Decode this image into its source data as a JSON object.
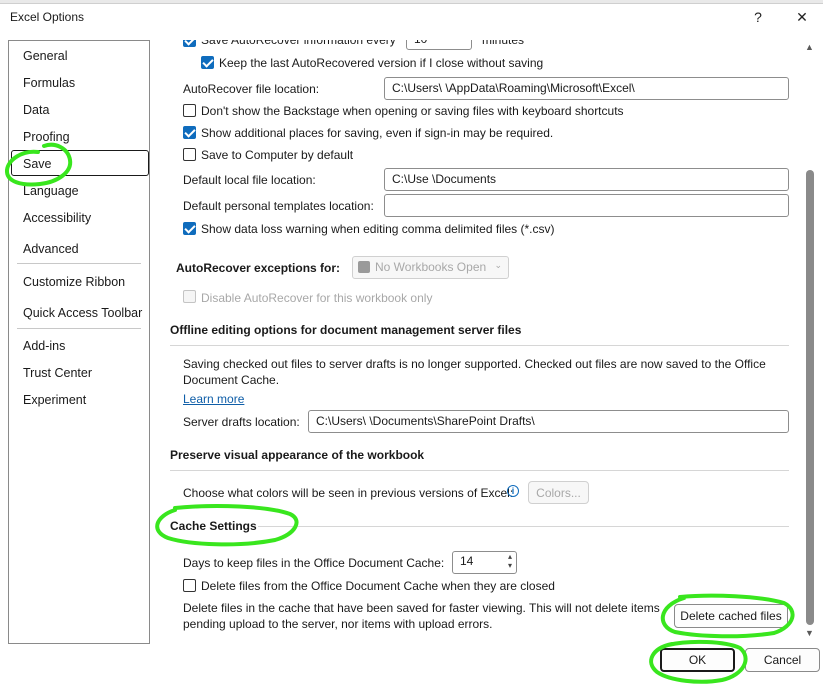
{
  "window": {
    "title": "Excel Options",
    "help": "?",
    "close": "✕"
  },
  "sidebar": {
    "items": [
      {
        "label": "General"
      },
      {
        "label": "Formulas"
      },
      {
        "label": "Data"
      },
      {
        "label": "Proofing"
      },
      {
        "label": "Save"
      },
      {
        "label": "Language"
      },
      {
        "label": "Accessibility"
      },
      {
        "label": "Advanced"
      },
      {
        "label": "Customize Ribbon"
      },
      {
        "label": "Quick Access Toolbar"
      },
      {
        "label": "Add-ins"
      },
      {
        "label": "Trust Center"
      },
      {
        "label": "Experiment"
      }
    ],
    "selected": "Save"
  },
  "save": {
    "autorecover_every_label": "Save AutoRecover information every",
    "autorecover_minutes_value": "10",
    "minutes_label": "minutes",
    "keep_last_label": "Keep the last AutoRecovered version if I close without saving",
    "autorecover_location_label": "AutoRecover file location:",
    "autorecover_location_value": "C:\\Users\\          \\AppData\\Roaming\\Microsoft\\Excel\\",
    "dont_show_backstage_label": "Don't show the Backstage when opening or saving files with keyboard shortcuts",
    "show_additional_label": "Show additional places for saving, even if sign-in may be required.",
    "save_to_computer_label": "Save to Computer by default",
    "default_local_label": "Default local file location:",
    "default_local_value": "C:\\Use                 \\Documents",
    "default_templates_label": "Default personal templates location:",
    "default_templates_value": "",
    "data_loss_label": "Show data loss warning when editing comma delimited files (*.csv)"
  },
  "exceptions": {
    "label": "AutoRecover exceptions for:",
    "workbook_value": "No Workbooks Open",
    "disable_label": "Disable AutoRecover for this workbook only"
  },
  "offline": {
    "heading": "Offline editing options for document management server files",
    "desc_line1": "Saving checked out files to server drafts is no longer supported. Checked out files are now saved to the Office",
    "desc_line2": "Document Cache.",
    "learn_more": "Learn more",
    "server_drafts_label": "Server drafts location:",
    "server_drafts_value": "C:\\Users\\                    \\Documents\\SharePoint Drafts\\"
  },
  "preserve": {
    "heading": "Preserve visual appearance of the workbook",
    "colors_label": "Choose what colors will be seen in previous versions of Excel:",
    "colors_button": "Colors..."
  },
  "cache": {
    "heading": "Cache Settings",
    "days_label": "Days to keep files in the Office Document Cache:",
    "days_value": "14",
    "delete_closed_label": "Delete files from the Office Document Cache when they are closed",
    "delete_desc_line1": "Delete files in the cache that have been saved for faster viewing. This will not delete items",
    "delete_desc_line2": "pending upload to the server, nor items with upload errors.",
    "delete_button": "Delete cached files"
  },
  "footer": {
    "ok": "OK",
    "cancel": "Cancel"
  },
  "colors": {
    "accent": "#0f6cbd",
    "annotation": "#39e61e"
  }
}
